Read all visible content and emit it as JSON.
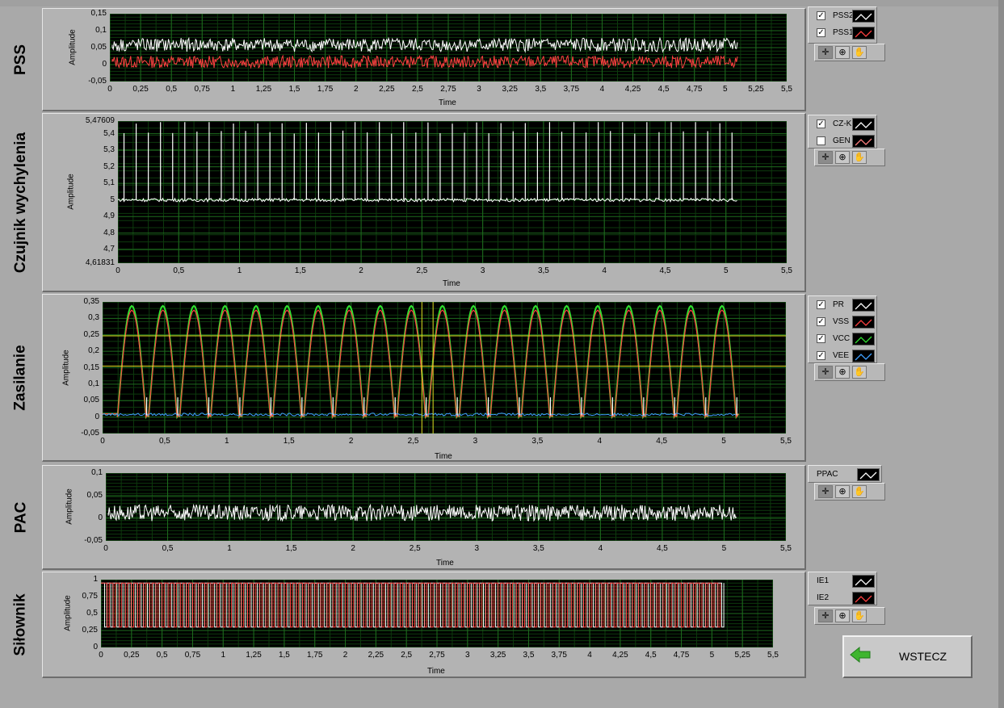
{
  "charts": [
    {
      "id": "pss",
      "section_label": "PSS",
      "xlabel": "Time",
      "ylabel": "Amplitude",
      "y_ticks": [
        "0,15",
        "0,1",
        "0,05",
        "0",
        "-0,05"
      ],
      "x_ticks": [
        "0",
        "0,25",
        "0,5",
        "0,75",
        "1",
        "1,25",
        "1,5",
        "1,75",
        "2",
        "2,25",
        "2,5",
        "2,75",
        "3",
        "3,25",
        "3,5",
        "3,75",
        "4",
        "4,25",
        "4,5",
        "4,75",
        "5",
        "5,25",
        "5,5"
      ],
      "legend": [
        {
          "name": "PSS2",
          "checked": true,
          "color": "#ffffff"
        },
        {
          "name": "PSS1",
          "checked": true,
          "color": "#ff4040"
        }
      ]
    },
    {
      "id": "czujnik",
      "section_label": "Czujnik wychylenia",
      "xlabel": "Time",
      "ylabel": "Amplitude",
      "y_ticks": [
        "5,47609",
        "5,4",
        "5,3",
        "5,2",
        "5,1",
        "5",
        "4,9",
        "4,8",
        "4,7",
        "4,61831"
      ],
      "x_ticks": [
        "0",
        "0,5",
        "1",
        "1,5",
        "2",
        "2,5",
        "3",
        "3,5",
        "4",
        "4,5",
        "5",
        "5,5"
      ],
      "legend": [
        {
          "name": "CZ-K",
          "checked": true,
          "color": "#ffffff"
        },
        {
          "name": "GEN",
          "checked": false,
          "color": "#ff8080"
        }
      ]
    },
    {
      "id": "zasilanie",
      "section_label": "Zasilanie",
      "xlabel": "Time",
      "ylabel": "Amplitude",
      "y_ticks": [
        "0,35",
        "0,3",
        "0,25",
        "0,2",
        "0,15",
        "0,1",
        "0,05",
        "0",
        "-0,05"
      ],
      "x_ticks": [
        "0",
        "0,5",
        "1",
        "1,5",
        "2",
        "2,5",
        "3",
        "3,5",
        "4",
        "4,5",
        "5",
        "5,5"
      ],
      "legend": [
        {
          "name": "PR",
          "checked": true,
          "color": "#ffffff"
        },
        {
          "name": "VSS",
          "checked": true,
          "color": "#ff4040"
        },
        {
          "name": "VCC",
          "checked": true,
          "color": "#30e030"
        },
        {
          "name": "VEE",
          "checked": true,
          "color": "#40a0ff"
        }
      ]
    },
    {
      "id": "pac",
      "section_label": "PAC",
      "xlabel": "Time",
      "ylabel": "Amplitude",
      "y_ticks": [
        "0,1",
        "0,05",
        "0",
        "-0,05"
      ],
      "x_ticks": [
        "0",
        "0,5",
        "1",
        "1,5",
        "2",
        "2,5",
        "3",
        "3,5",
        "4",
        "4,5",
        "5",
        "5,5"
      ],
      "legend": [
        {
          "name": "PPAC",
          "checked": null,
          "color": "#ffffff"
        }
      ]
    },
    {
      "id": "silownik",
      "section_label": "Siłownik",
      "xlabel": "Time",
      "ylabel": "Amplitude",
      "y_ticks": [
        "1",
        "0,75",
        "0,5",
        "0,25",
        "0"
      ],
      "x_ticks": [
        "0",
        "0,25",
        "0,5",
        "0,75",
        "1",
        "1,25",
        "1,5",
        "1,75",
        "2",
        "2,25",
        "2,5",
        "2,75",
        "3",
        "3,25",
        "3,5",
        "3,75",
        "4",
        "4,25",
        "4,5",
        "4,75",
        "5",
        "5,25",
        "5,5"
      ],
      "legend": [
        {
          "name": "IE1",
          "checked": null,
          "color": "#ffffff"
        },
        {
          "name": "IE2",
          "checked": null,
          "color": "#ff4040"
        }
      ]
    }
  ],
  "back_button": {
    "label": "WSTECZ"
  },
  "tool_icons": [
    "cursor-move-icon",
    "zoom-icon",
    "pan-hand-icon"
  ]
}
